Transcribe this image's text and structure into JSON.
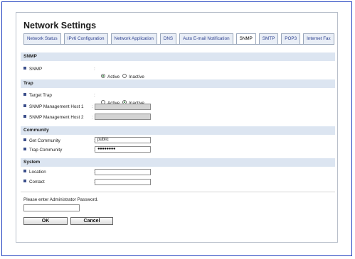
{
  "page": {
    "title": "Network Settings"
  },
  "tabs": [
    {
      "label": "Network Status",
      "active": false
    },
    {
      "label": "IPv6 Configuration",
      "active": false
    },
    {
      "label": "Network Application",
      "active": false
    },
    {
      "label": "DNS",
      "active": false
    },
    {
      "label": "Auto E-mail Notification",
      "active": false
    },
    {
      "label": "SNMP",
      "active": true
    },
    {
      "label": "SMTP",
      "active": false
    },
    {
      "label": "POP3",
      "active": false
    },
    {
      "label": "Internet Fax",
      "active": false
    }
  ],
  "sections": {
    "snmp": {
      "heading": "SNMP",
      "snmp_label": "SNMP",
      "snmp_colon": ":",
      "snmp_active": "Active",
      "snmp_inactive": "Inactive",
      "snmp_selected": "Active"
    },
    "trap": {
      "heading": "Trap",
      "target_trap_label": "Target Trap",
      "target_trap_colon": ":",
      "target_trap_active": "Active",
      "target_trap_inactive": "Inactive",
      "target_trap_selected": "Inactive",
      "host1_label": "SNMP Management Host 1",
      "host1_colon": ":",
      "host1_value": "",
      "host2_label": "SNMP Management Host 2",
      "host2_colon": ":",
      "host2_value": ""
    },
    "community": {
      "heading": "Community",
      "get_label": "Get Community",
      "get_colon": ":",
      "get_value": "public",
      "trap_label": "Trap Community",
      "trap_colon": ":",
      "trap_value": "●●●●●●●●"
    },
    "system": {
      "heading": "System",
      "location_label": "Location",
      "location_colon": ":",
      "location_value": "",
      "contact_label": "Contact",
      "contact_colon": ":",
      "contact_value": ""
    }
  },
  "password": {
    "prompt": "Please enter Administrator Password.",
    "value": ""
  },
  "buttons": {
    "ok": "OK",
    "cancel": "Cancel"
  },
  "colors": {
    "frame": "#1f3fbf",
    "section_bg": "#dce5f1",
    "radio_on": "#1d7a2b"
  }
}
